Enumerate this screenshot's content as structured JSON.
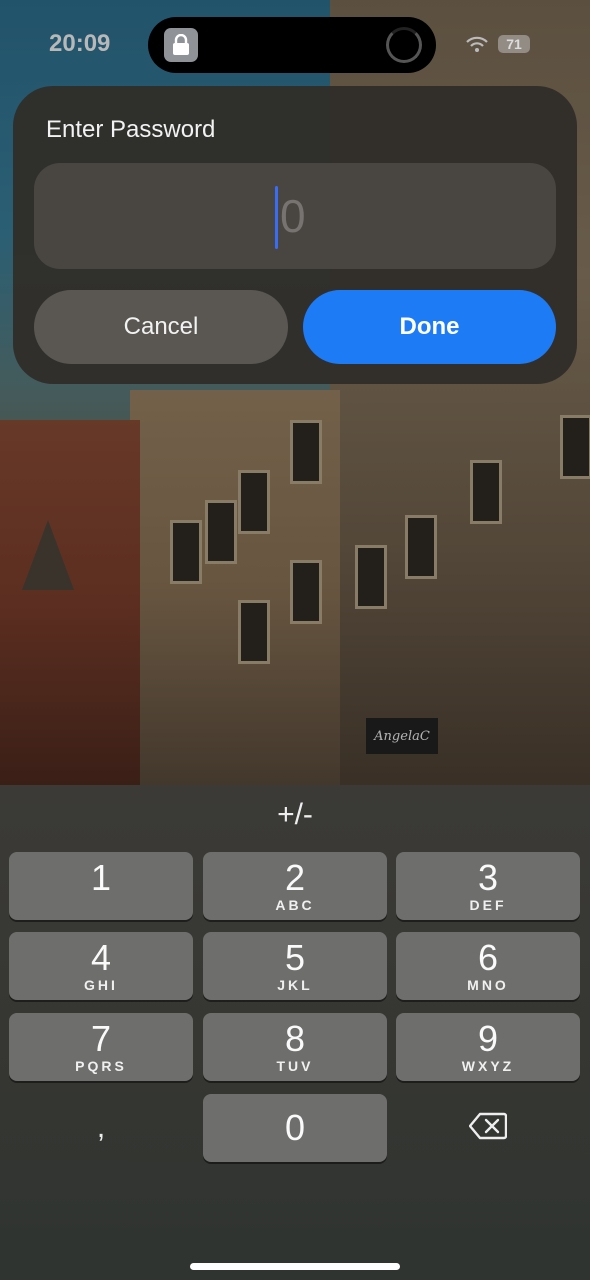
{
  "status_bar": {
    "time": "20:09",
    "battery": "71",
    "lock_icon": "lock-icon",
    "wifi_icon": "wifi-icon"
  },
  "background": {
    "shop_sign": "AngelaC"
  },
  "dialog": {
    "title": "Enter Password",
    "field_value": "",
    "field_placeholder": "0",
    "cancel_label": "Cancel",
    "done_label": "Done",
    "accent": "#1d7cf5"
  },
  "keyboard": {
    "sign_key": "+/-",
    "keys": [
      {
        "digit": "1",
        "letters": ""
      },
      {
        "digit": "2",
        "letters": "ABC"
      },
      {
        "digit": "3",
        "letters": "DEF"
      },
      {
        "digit": "4",
        "letters": "GHI"
      },
      {
        "digit": "5",
        "letters": "JKL"
      },
      {
        "digit": "6",
        "letters": "MNO"
      },
      {
        "digit": "7",
        "letters": "PQRS"
      },
      {
        "digit": "8",
        "letters": "TUV"
      },
      {
        "digit": "9",
        "letters": "WXYZ"
      }
    ],
    "comma_key": ",",
    "zero_key": "0",
    "delete_icon": "backspace-icon"
  }
}
